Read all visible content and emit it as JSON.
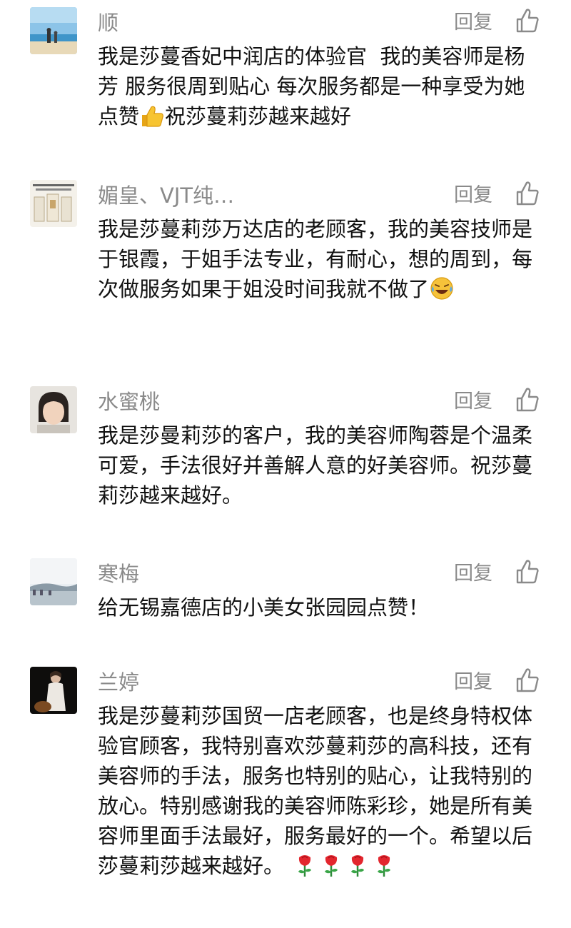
{
  "comments": [
    {
      "name": "顺",
      "reply_label": "回复",
      "text_before": "我是莎蔓香妃中润店的体验官  我的美容师是杨芳 服务很周到贴心 每次服务都是一种享受为她点赞",
      "text_after": "祝莎蔓莉莎越来越好",
      "emoji": "thumbs-up"
    },
    {
      "name": "媚皇、VJT纯…",
      "reply_label": "回复",
      "text_before": "我是莎蔓莉莎万达店的老顾客，我的美容技师是于银霞，于姐手法专业，有耐心，想的周到，每次做服务如果于姐没时间我就不做了",
      "text_after": "",
      "emoji": "laughing-crying"
    },
    {
      "name": "水蜜桃",
      "reply_label": "回复",
      "text_before": "我是莎曼莉莎的客户，我的美容师陶蓉是个温柔可爱，手法很好并善解人意的好美容师。祝莎蔓莉莎越来越好。",
      "text_after": "",
      "emoji": ""
    },
    {
      "name": "寒梅",
      "reply_label": "回复",
      "text_before": "给无锡嘉德店的小美女张园园点赞！",
      "text_after": "",
      "emoji": ""
    },
    {
      "name": "兰婷",
      "reply_label": "回复",
      "text_before": "我是莎蔓莉莎国贸一店老顾客，也是终身特权体验官顾客，我特别喜欢莎蔓莉莎的高科技，还有美容师的手法，服务也特别的贴心，让我特别的放心。特别感谢我的美容师陈彩珍，她是所有美容师里面手法最好，服务最好的一个。希望以后莎蔓莉莎越来越好。",
      "text_after": "",
      "emoji": "rose-x4"
    }
  ],
  "colors": {
    "name": "#8a8a8a",
    "body_text": "#111111",
    "action": "#8a8a8a",
    "background": "#ffffff"
  },
  "icons": {
    "like": "thumbs-up-outline-icon",
    "reply": "text-link"
  }
}
